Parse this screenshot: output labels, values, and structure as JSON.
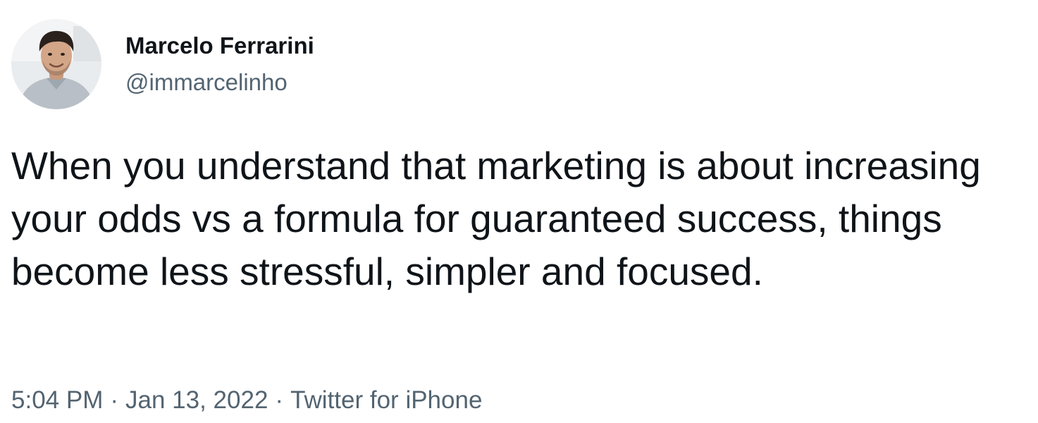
{
  "author": {
    "display_name": "Marcelo Ferrarini",
    "handle": "@immarcelinho",
    "avatar_icon": "profile-photo-icon"
  },
  "tweet": {
    "text": "When you understand that marketing is about increasing your odds vs a formula for guaranteed success, things become less stressful, simpler and focused."
  },
  "meta": {
    "time": "5:04 PM",
    "separator": "·",
    "date": "Jan 13, 2022",
    "source": "Twitter for iPhone"
  },
  "colors": {
    "text_primary": "#0f1419",
    "text_secondary": "#536471",
    "background": "#ffffff"
  }
}
